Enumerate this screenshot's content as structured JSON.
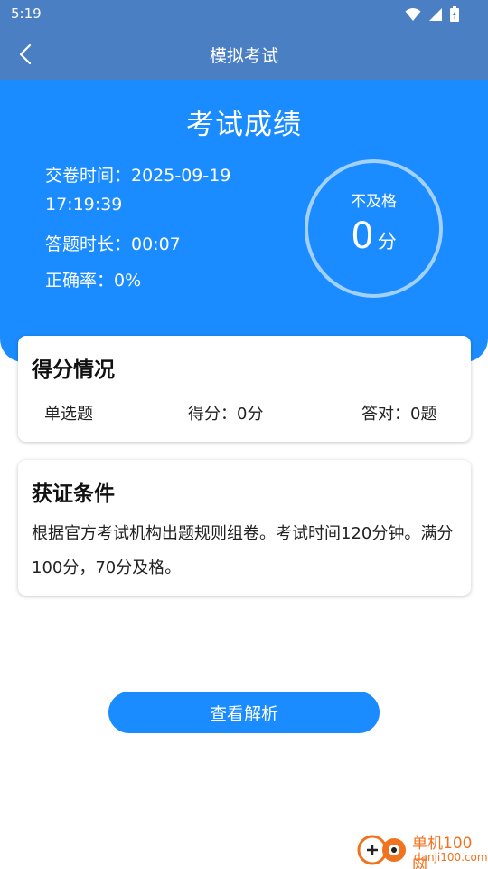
{
  "status_bar": {
    "time": "5:19"
  },
  "app_bar": {
    "title": "模拟考试"
  },
  "result": {
    "title": "考试成绩",
    "submit_time_label": "交卷时间：2025-09-19",
    "submit_time_clock": "17:19:39",
    "duration": "答题时长：00:07",
    "accuracy": "正确率：0%",
    "status": "不及格",
    "score": "0",
    "score_unit": "分"
  },
  "score_card": {
    "title": "得分情况",
    "row": {
      "type": "单选题",
      "score": "得分：0分",
      "correct": "答对：0题"
    }
  },
  "cert_card": {
    "title": "获证条件",
    "text": "根据官方考试机构出题规则组卷。考试时间120分钟。满分100分，70分及格。"
  },
  "actions": {
    "view_analysis": "查看解析"
  },
  "watermark": {
    "name": "单机100网",
    "url": "danji100.com"
  },
  "colors": {
    "app_bar": "#4a7fc4",
    "accent": "#1a8cff",
    "watermark": "#f0731f"
  }
}
